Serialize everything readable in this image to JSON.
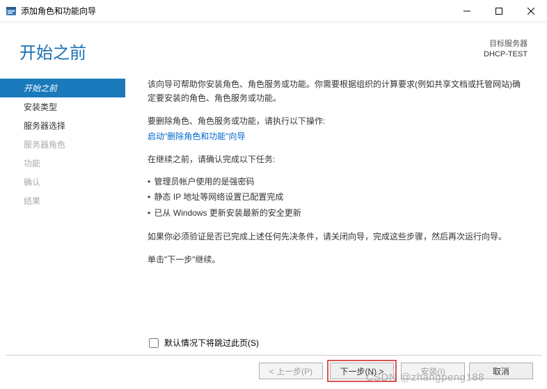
{
  "titlebar": {
    "title": "添加角色和功能向导"
  },
  "header": {
    "heading": "开始之前",
    "target_label": "目标服务器",
    "server_name": "DHCP-TEST"
  },
  "sidebar": {
    "items": [
      {
        "label": "开始之前",
        "state": "active"
      },
      {
        "label": "安装类型",
        "state": "enabled"
      },
      {
        "label": "服务器选择",
        "state": "enabled"
      },
      {
        "label": "服务器角色",
        "state": "disabled"
      },
      {
        "label": "功能",
        "state": "disabled"
      },
      {
        "label": "确认",
        "state": "disabled"
      },
      {
        "label": "结果",
        "state": "disabled"
      }
    ]
  },
  "content": {
    "intro": "该向导可帮助你安装角色、角色服务或功能。你需要根据组织的计算要求(例如共享文档或托管网站)确定要安装的角色、角色服务或功能。",
    "remove_label": "要删除角色、角色服务或功能，请执行以下操作:",
    "remove_link": "启动\"删除角色和功能\"向导",
    "before_continue": "在继续之前，请确认完成以下任务:",
    "tasks": [
      "管理员帐户使用的是强密码",
      "静态 IP 地址等网络设置已配置完成",
      "已从 Windows 更新安装最新的安全更新"
    ],
    "verify_note": "如果你必须验证是否已完成上述任何先决条件，请关闭向导，完成这些步骤，然后再次运行向导。",
    "continue_note": "单击\"下一步\"继续。"
  },
  "skip": {
    "label": "默认情况下将跳过此页(S)"
  },
  "footer": {
    "prev": "< 上一步(P)",
    "next": "下一步(N) >",
    "install": "安装(I)",
    "cancel": "取消"
  },
  "watermark": "CSDN @zhangpeng188"
}
